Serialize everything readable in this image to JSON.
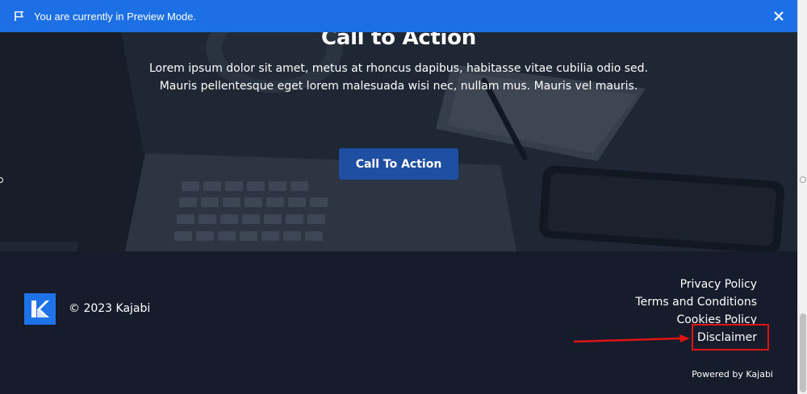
{
  "preview_bar": {
    "message": "You are currently in Preview Mode.",
    "icon": "flag-icon",
    "close_icon": "close-icon",
    "color": "#1c6fe4"
  },
  "hero": {
    "title": "Call to Action",
    "body_line1": "Lorem ipsum dolor sit amet, metus at rhoncus dapibus, habitasse vitae cubilia odio sed.",
    "body_line2": "Mauris pellentesque eget lorem malesuada wisi nec, nullam mus. Mauris vel mauris.",
    "button_label": "Call To Action",
    "button_color": "#1f4fa3"
  },
  "footer": {
    "copyright": "© 2023 Kajabi",
    "logo": "kajabi-logo",
    "links": [
      "Privacy Policy",
      "Terms and Conditions",
      "Cookies Policy",
      "Disclaimer"
    ],
    "powered_by": "Powered by Kajabi",
    "background": "#161c2b"
  },
  "annotation": {
    "highlight_color": "#e21313",
    "target": "Disclaimer"
  }
}
